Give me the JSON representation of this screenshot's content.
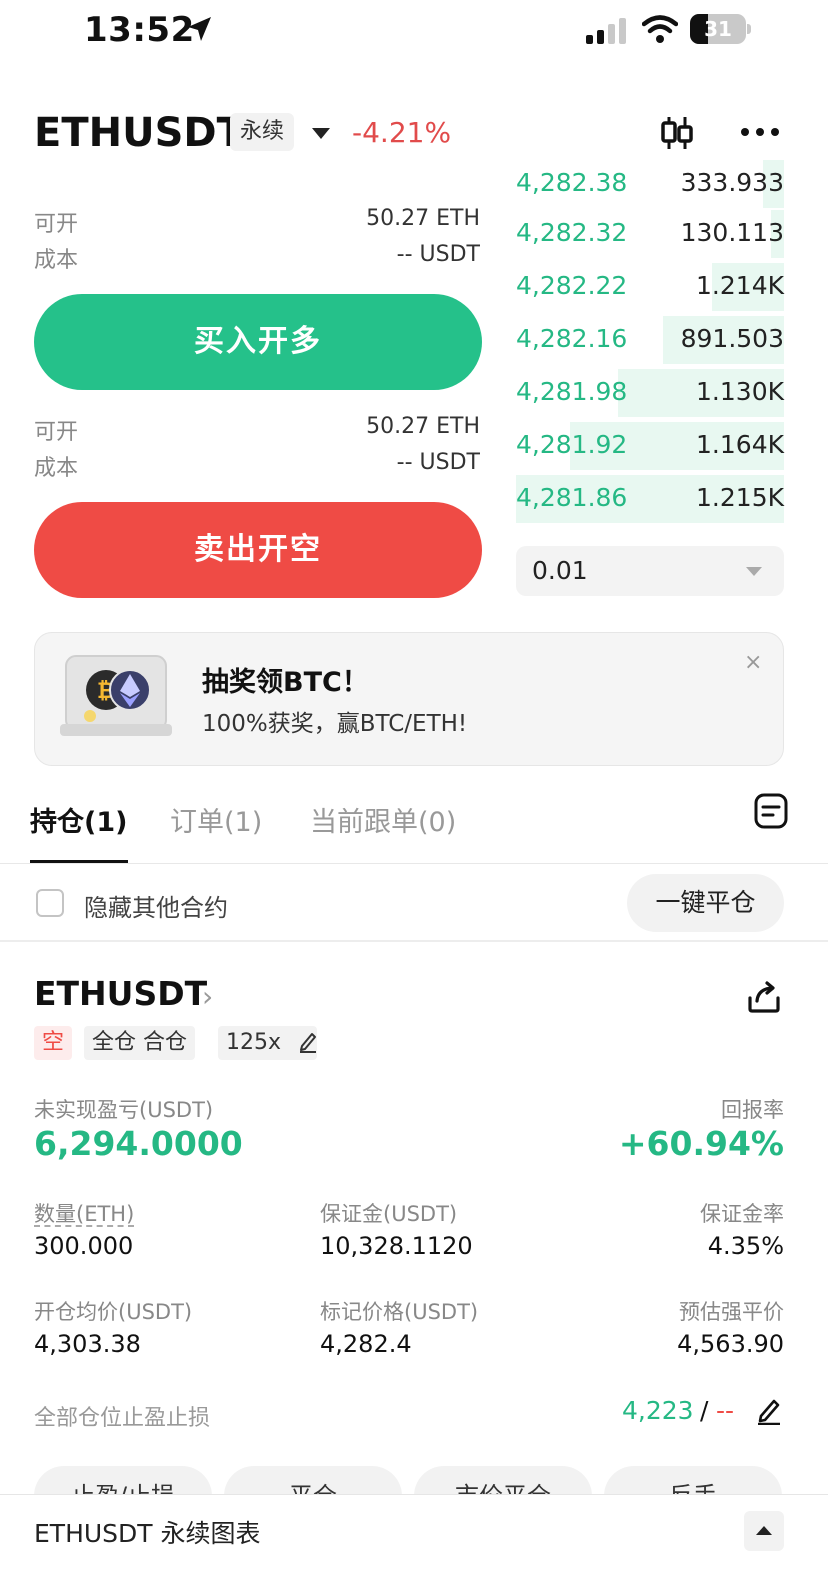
{
  "status_bar": {
    "time": "13:52",
    "battery": "31"
  },
  "header": {
    "symbol": "ETHUSDT",
    "contract_type": "永续",
    "change": "-4.21%",
    "icons": [
      "candlestick-icon",
      "more-icon"
    ]
  },
  "order_form": {
    "long": {
      "available_label": "可开",
      "available_value": "50.27 ETH",
      "cost_label": "成本",
      "cost_value": "-- USDT",
      "button_label": "买入开多"
    },
    "short": {
      "available_label": "可开",
      "available_value": "50.27 ETH",
      "cost_label": "成本",
      "cost_value": "-- USDT",
      "button_label": "卖出开空"
    }
  },
  "order_book": {
    "bids": [
      {
        "price": "4,282.38",
        "qty": "333.933",
        "depth": 0.08
      },
      {
        "price": "4,282.32",
        "qty": "130.113",
        "depth": 0.05
      },
      {
        "price": "4,282.22",
        "qty": "1.214K",
        "depth": 0.27
      },
      {
        "price": "4,282.16",
        "qty": "891.503",
        "depth": 0.45
      },
      {
        "price": "4,281.98",
        "qty": "1.130K",
        "depth": 0.62
      },
      {
        "price": "4,281.92",
        "qty": "1.164K",
        "depth": 0.8
      },
      {
        "price": "4,281.86",
        "qty": "1.215K",
        "depth": 1.0
      }
    ],
    "precision": "0.01"
  },
  "banner": {
    "title": "抽奖领BTC！",
    "subtitle": "100%获奖，赢BTC/ETH!",
    "close": "×"
  },
  "tabs": [
    {
      "label": "持仓(1)",
      "active": true
    },
    {
      "label": "订单(1)",
      "active": false
    },
    {
      "label": "当前跟单(0)",
      "active": false
    }
  ],
  "filter": {
    "hide_other_label": "隐藏其他合约",
    "close_all_label": "一键平仓"
  },
  "position": {
    "symbol": "ETHUSDT",
    "side_tag": "空",
    "mode_tag": "全仓 合仓",
    "leverage_tag": "125x",
    "unrealized_pnl_label": "未实现盈亏(USDT)",
    "unrealized_pnl_value": "6,294.0000",
    "roe_label": "回报率",
    "roe_value": "+60.94%",
    "qty_label": "数量(ETH)",
    "qty_value": "300.000",
    "margin_label": "保证金(USDT)",
    "margin_value": "10,328.1120",
    "margin_ratio_label": "保证金率",
    "margin_ratio_value": "4.35%",
    "entry_label": "开仓均价(USDT)",
    "entry_value": "4,303.38",
    "mark_label": "标记价格(USDT)",
    "mark_value": "4,282.4",
    "liq_label": "预估强平价",
    "liq_value": "4,563.90",
    "tpsl_label": "全部仓位止盈止损",
    "tp_value": "4,223",
    "slash": "/",
    "sl_value": "--",
    "actions": [
      "止盈/止损",
      "平仓",
      "市价平仓",
      "反手"
    ]
  },
  "bottom_bar": {
    "title": "ETHUSDT 永续图表"
  },
  "colors": {
    "green": "#25c18a",
    "red": "#ef4b45"
  }
}
